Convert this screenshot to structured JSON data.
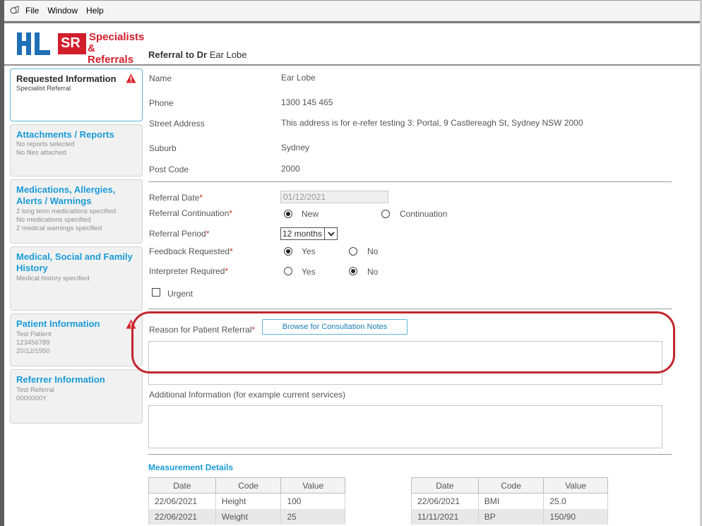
{
  "menu": {
    "items": [
      "File",
      "Window",
      "Help"
    ]
  },
  "logo": {
    "hl_text": "HL",
    "sr_letters": "SR",
    "sr_line1": "Specialists",
    "sr_line2": "& Referrals"
  },
  "header": {
    "title_prefix": "Referral to Dr",
    "title_name": "Ear Lobe"
  },
  "sidebar": {
    "items": [
      {
        "title": "Requested Information",
        "lines": [
          "Specialist Referral"
        ],
        "warning": true,
        "active": true
      },
      {
        "title": "Attachments / Reports",
        "lines": [
          "No reports selected",
          "No files attached"
        ],
        "warning": false
      },
      {
        "title": "Medications, Allergies, Alerts / Warnings",
        "lines": [
          "2 long term medications specified",
          "No medications specified",
          "2 medical warnings specified"
        ],
        "warning": false
      },
      {
        "title": "Medical, Social and Family History",
        "lines": [
          "Medical history specified"
        ],
        "warning": false
      },
      {
        "title": "Patient Information",
        "lines": [
          "Test Patient",
          "123456789",
          "20/12/1950"
        ],
        "warning": true
      },
      {
        "title": "Referrer Information",
        "lines": [
          "Test Referral",
          "0000000Y"
        ],
        "warning": false
      }
    ]
  },
  "details": {
    "name_label": "Name",
    "name": "Ear Lobe",
    "phone_label": "Phone",
    "phone": "1300 145 465",
    "address_label": "Street Address",
    "address": "This address is for e-refer testing 3: Portal, 9 Castlereagh St, Sydney NSW 2000",
    "suburb_label": "Suburb",
    "suburb": "Sydney",
    "postcode_label": "Post Code",
    "postcode": "2000"
  },
  "form": {
    "referral_date_label": "Referral Date",
    "referral_date": "01/12/2021",
    "continuation_label": "Referral Continuation",
    "continuation_options": [
      "New",
      "Continuation"
    ],
    "continuation_selected": "New",
    "period_label": "Referral Period",
    "period": "12 months",
    "feedback_label": "Feedback Requested",
    "feedback_options": [
      "Yes",
      "No"
    ],
    "feedback_selected": "Yes",
    "interpreter_label": "Interpreter Required",
    "interpreter_options": [
      "Yes",
      "No"
    ],
    "interpreter_selected": "No",
    "urgent_label": "Urgent",
    "urgent_checked": false,
    "reason_label": "Reason for Patient Referral",
    "reason_value": "",
    "browse_button": "Browse for Consultation Notes",
    "additional_label": "Additional Information (for example current services)",
    "additional_value": ""
  },
  "measurements": {
    "title": "Measurement Details",
    "columns": [
      "Date",
      "Code",
      "Value"
    ],
    "left_rows": [
      [
        "22/06/2021",
        "Height",
        "100"
      ],
      [
        "22/06/2021",
        "Weight",
        "25"
      ]
    ],
    "right_rows": [
      [
        "22/06/2021",
        "BMI",
        "25.0"
      ],
      [
        "11/11/2021",
        "BP",
        "150/90"
      ]
    ]
  },
  "colors": {
    "accent": "#1a9bd7",
    "brand_red": "#d21e2b",
    "highlight": "#c1272d",
    "required": "#c0392b"
  }
}
